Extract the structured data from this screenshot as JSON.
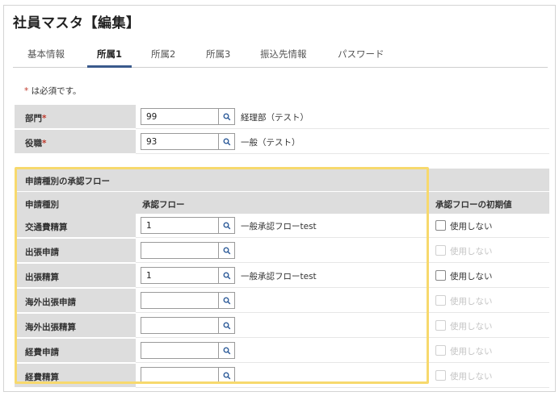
{
  "page": {
    "title": "社員マスタ【編集】"
  },
  "tabs": [
    {
      "label": "基本情報"
    },
    {
      "label": "所属1"
    },
    {
      "label": "所属2"
    },
    {
      "label": "所属3"
    },
    {
      "label": "振込先情報"
    },
    {
      "label": "パスワード"
    }
  ],
  "active_tab": "所属1",
  "required_note": {
    "mark": "*",
    "text": " は必須です。"
  },
  "fields": {
    "department": {
      "label": "部門",
      "mark": "*",
      "code": "99",
      "name": "経理部（テスト）"
    },
    "position": {
      "label": "役職",
      "mark": "*",
      "code": "93",
      "name": "一般（テスト）"
    }
  },
  "approval": {
    "section_title": "申請種別の承認フロー",
    "columns": {
      "type": "申請種別",
      "flow": "承認フロー",
      "default": "承認フローの初期値"
    },
    "checkbox_label": "使用しない",
    "rows": [
      {
        "type": "交通費精算",
        "code": "1",
        "flow_name": "一般承認フローtest",
        "enabled": true
      },
      {
        "type": "出張申請",
        "code": "",
        "flow_name": "",
        "enabled": false
      },
      {
        "type": "出張精算",
        "code": "1",
        "flow_name": "一般承認フローtest",
        "enabled": true
      },
      {
        "type": "海外出張申請",
        "code": "",
        "flow_name": "",
        "enabled": false
      },
      {
        "type": "海外出張精算",
        "code": "",
        "flow_name": "",
        "enabled": false
      },
      {
        "type": "経費申請",
        "code": "",
        "flow_name": "",
        "enabled": false
      },
      {
        "type": "経費精算",
        "code": "",
        "flow_name": "",
        "enabled": false
      }
    ]
  },
  "colors": {
    "accent": "#3a5a8c",
    "required": "#c0392b",
    "highlight": "#f7d96d",
    "label_bg": "#dddddd"
  }
}
